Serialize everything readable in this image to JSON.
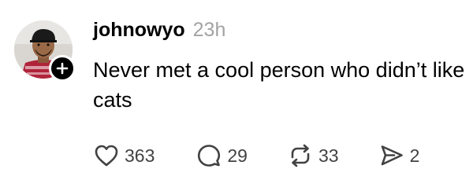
{
  "post": {
    "author": {
      "username": "johnowyo",
      "avatar_icon": "avatar-photo",
      "follow_icon": "plus-icon"
    },
    "timestamp": "23h",
    "text": "Never met a cool person who didn’t like cats",
    "actions": {
      "like": {
        "icon": "heart-icon",
        "count": "363"
      },
      "reply": {
        "icon": "speech-bubble-icon",
        "count": "29"
      },
      "repost": {
        "icon": "repost-arrows-icon",
        "count": "33"
      },
      "share": {
        "icon": "send-icon",
        "count": "2"
      }
    }
  },
  "colors": {
    "text": "#000000",
    "timestamp": "#a3a3a3",
    "count": "#424242",
    "icon": "#424242",
    "badge": "#000000"
  }
}
